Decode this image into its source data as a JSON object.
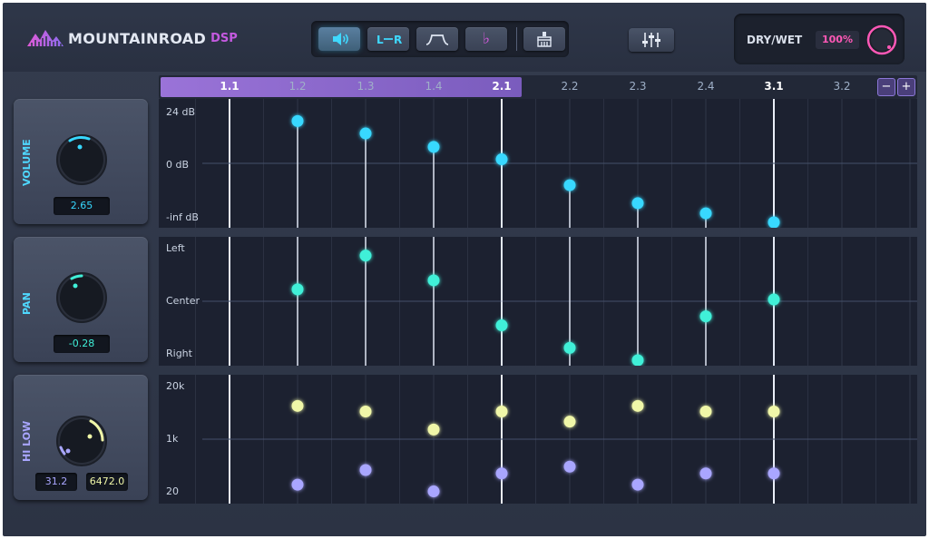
{
  "header": {
    "brand": "MOUNTAINROAD",
    "brand_sub": "DSP",
    "toolbar": [
      {
        "name": "speaker-button",
        "icon": "speaker-icon",
        "active": true
      },
      {
        "name": "lr-button",
        "label": "L⁠—R",
        "active": false
      },
      {
        "name": "filter-shape-button",
        "icon": "filter-shape-icon",
        "active": false
      },
      {
        "name": "flat-button",
        "label": "♭",
        "active": false
      },
      {
        "name": "clear-button",
        "icon": "brush-icon",
        "active": false
      }
    ],
    "drywet": {
      "label": "DRY/WET",
      "value": "100%"
    }
  },
  "ruler": {
    "steps": [
      "1.1",
      "1.2",
      "1.3",
      "1.4",
      "2.1",
      "2.2",
      "2.3",
      "2.4",
      "3.1",
      "3.2"
    ],
    "strong": [
      "1.1",
      "2.1",
      "3.1"
    ],
    "selected_through": "2.1",
    "zoom_out": "−",
    "zoom_in": "+"
  },
  "panels": {
    "volume": {
      "title": "VOLUME",
      "value": "2.65",
      "axis": [
        "24 dB",
        "0 dB",
        "-inf dB"
      ]
    },
    "pan": {
      "title": "PAN",
      "value": "-0.28",
      "axis": [
        "Left",
        "Center",
        "Right"
      ]
    },
    "hilow": {
      "title": "HI LOW",
      "low_value": "31.2",
      "high_value": "6472.0",
      "axis": [
        "20k",
        "1k",
        "20"
      ]
    }
  },
  "sequence": {
    "volume_levels": [
      0.9,
      0.79,
      0.67,
      0.56,
      0.33,
      0.17,
      0.08,
      0.0
    ],
    "pan_levels": [
      0.63,
      0.93,
      0.71,
      0.31,
      0.11,
      0.0,
      0.39,
      0.54
    ],
    "hi_levels": [
      0.82,
      0.77,
      0.61,
      0.77,
      0.68,
      0.82,
      0.77,
      0.77
    ],
    "low_levels": [
      0.12,
      0.25,
      0.06,
      0.22,
      0.28,
      0.12,
      0.22,
      0.22
    ]
  },
  "colors": {
    "cyan": "#37d8ff",
    "teal": "#3ff0d8",
    "yellow": "#f0f7a8",
    "lavender": "#a9a6ff",
    "purple": "#9a73d8",
    "pink": "#ff58b6"
  }
}
